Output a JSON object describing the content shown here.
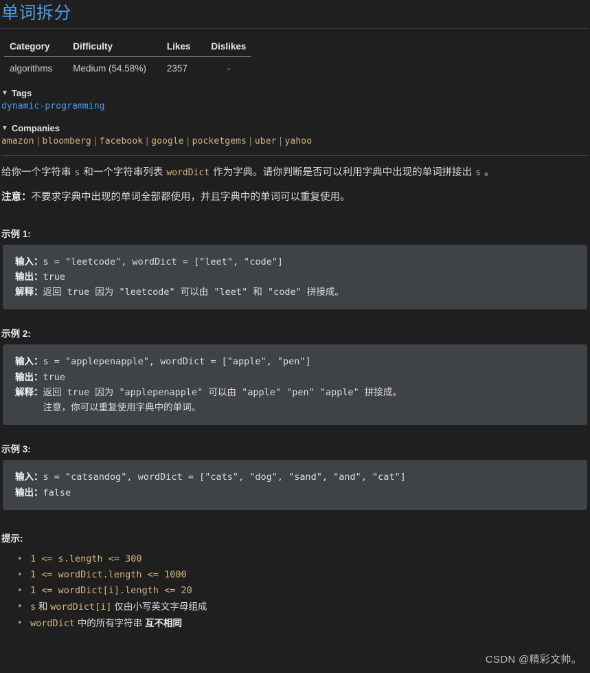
{
  "page": {
    "title": "单词拆分",
    "background_color": "#1f1f1f",
    "title_color": "#4d9de8",
    "code_block_color": "#3f4247",
    "accent_code_color": "#d5b483"
  },
  "meta_table": {
    "headers": [
      "Category",
      "Difficulty",
      "Likes",
      "Dislikes"
    ],
    "rows": [
      {
        "category": "algorithms",
        "difficulty": "Medium (54.58%)",
        "likes": "2357",
        "dislikes": "-"
      }
    ]
  },
  "tags_section": {
    "caret": "▼",
    "heading": "Tags",
    "items": [
      "dynamic-programming"
    ]
  },
  "companies_section": {
    "caret": "▼",
    "heading": "Companies",
    "separator": "|",
    "items": [
      "amazon",
      "bloomberg",
      "facebook",
      "google",
      "pocketgems",
      "uber",
      "yahoo"
    ]
  },
  "description": {
    "line1_part1": "给你一个字符串 ",
    "line1_code1": "s",
    "line1_part2": " 和一个字符串列表 ",
    "line1_code2": "wordDict",
    "line1_part3": " 作为字典。请你判断是否可以利用字典中出现的单词拼接出 ",
    "line1_code3": "s",
    "line1_part4": " 。",
    "note_label": "注意：",
    "note_text": "不要求字典中出现的单词全部都使用，并且字典中的单词可以重复使用。"
  },
  "examples": [
    {
      "label": "示例 1:",
      "lines": [
        {
          "prefix": "输入：",
          "text": "s = \"leetcode\", wordDict = [\"leet\", \"code\"]"
        },
        {
          "prefix": "输出：",
          "text": "true"
        },
        {
          "prefix": "解释：",
          "text": "返回 true 因为 \"leetcode\" 可以由 \"leet\" 和 \"code\" 拼接成。"
        }
      ]
    },
    {
      "label": "示例 2:",
      "lines": [
        {
          "prefix": "输入：",
          "text": "s = \"applepenapple\", wordDict = [\"apple\", \"pen\"]"
        },
        {
          "prefix": "输出：",
          "text": "true"
        },
        {
          "prefix": "解释：",
          "text": "返回 true 因为 \"applepenapple\" 可以由 \"apple\" \"pen\" \"apple\" 拼接成。"
        },
        {
          "prefix": "",
          "text": "     注意，你可以重复使用字典中的单词。"
        }
      ]
    },
    {
      "label": "示例 3:",
      "lines": [
        {
          "prefix": "输入：",
          "text": "s = \"catsandog\", wordDict = [\"cats\", \"dog\", \"sand\", \"and\", \"cat\"]"
        },
        {
          "prefix": "输出：",
          "text": "false"
        }
      ]
    }
  ],
  "hints": {
    "label": "提示:",
    "items": [
      {
        "code": "1 <= s.length <= 300",
        "zh": "",
        "zh_bold": ""
      },
      {
        "code": "1 <= wordDict.length <= 1000",
        "zh": "",
        "zh_bold": ""
      },
      {
        "code": "1 <= wordDict[i].length <= 20",
        "zh": "",
        "zh_bold": ""
      },
      {
        "code_a": "s",
        "zh_mid": " 和 ",
        "code_b": "wordDict[i]",
        "zh": " 仅由小写英文字母组成",
        "zh_bold": ""
      },
      {
        "code_a": "wordDict",
        "zh": " 中的所有字符串 ",
        "zh_bold": "互不相同"
      }
    ]
  },
  "watermark": {
    "text": "CSDN @精彩文帅。"
  }
}
